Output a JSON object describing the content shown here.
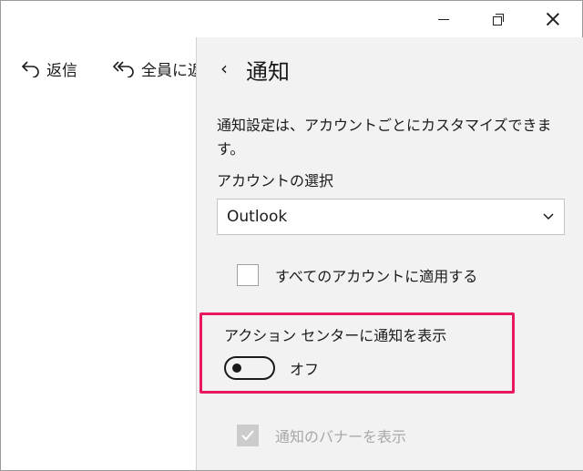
{
  "toolbar": {
    "reply_label": "返信",
    "reply_all_label": "全員に返",
    "reply_icon": "reply-icon",
    "reply_all_icon": "reply-all-icon"
  },
  "window_controls": {
    "minimize_icon": "minimize-icon",
    "restore_icon": "restore-icon",
    "close_icon": "close-icon"
  },
  "pane": {
    "back_glyph": "‹",
    "title": "通知",
    "description": "通知設定は、アカウントごとにカスタマイズできます。",
    "account_label": "アカウントの選択",
    "account_selected": "Outlook",
    "apply_all_label": "すべてのアカウントに適用する",
    "apply_all_checked": false,
    "action_center_label": "アクション センターに通知を表示",
    "action_center_toggle_on": false,
    "action_center_state": "オフ",
    "banner_label": "通知のバナーを表示",
    "banner_checked": true,
    "banner_disabled": true
  },
  "colors": {
    "highlight": "#e8195f",
    "pane_background": "#f2f2f2",
    "disabled_text": "#a8a8a8"
  }
}
